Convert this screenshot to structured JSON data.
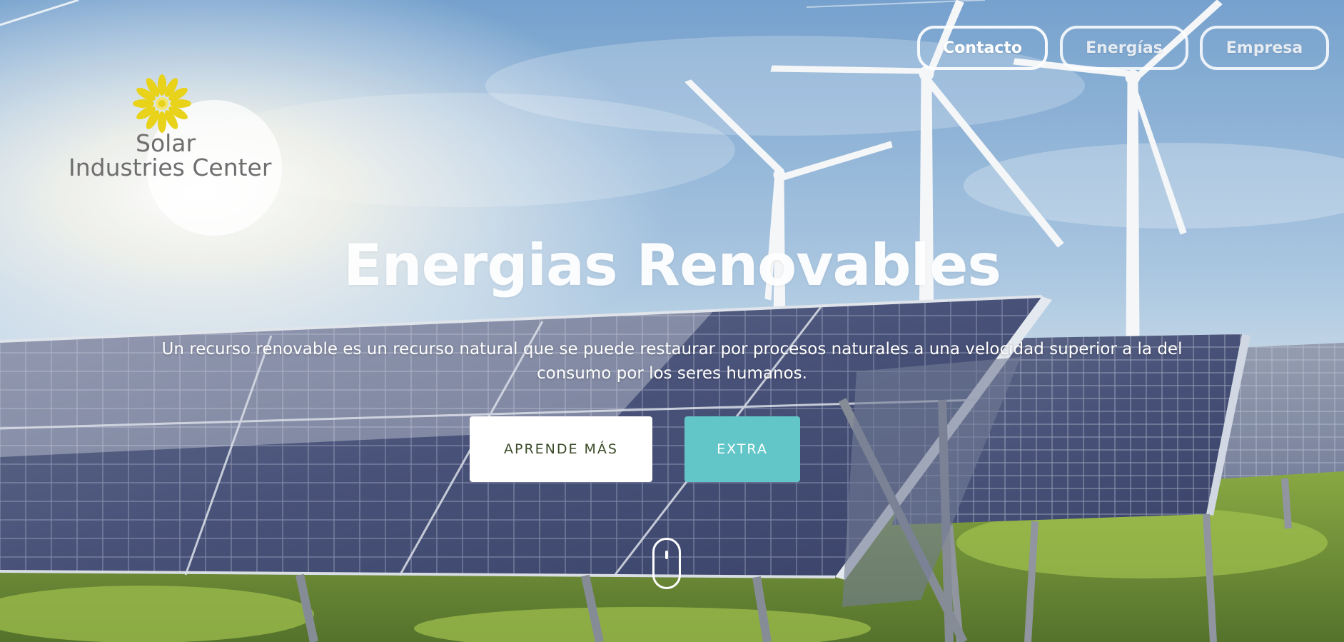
{
  "brand": {
    "line1": "Solar",
    "line2": "Industries Center",
    "logo_icon": "sunflower-icon",
    "logo_color": "#e8d21a",
    "text_color": "#6f6e6e"
  },
  "nav": {
    "items": [
      {
        "label": "Contacto"
      },
      {
        "label": "Energías"
      },
      {
        "label": "Empresa"
      }
    ]
  },
  "hero": {
    "title": "Energias Renovables",
    "subtitle": "Un recurso renovable es un recurso natural que se puede restaurar por procesos naturales a una velocidad superior a la del consumo por los seres humanos.",
    "primary_button": "APRENDE MÁS",
    "secondary_button": "EXTRA",
    "accent_color": "#62c6c8",
    "scroll_icon": "mouse-scroll-icon"
  }
}
